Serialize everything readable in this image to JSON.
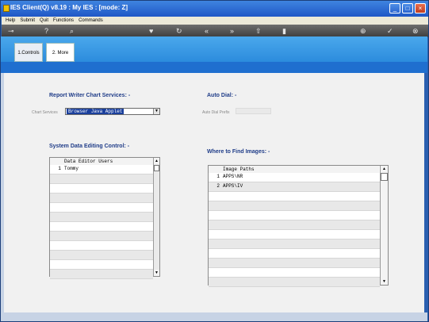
{
  "window": {
    "title": "IES Client(Q) v8.19 : My IES :     [mode: Z]",
    "minimize_glyph": "_",
    "maximize_glyph": "□",
    "close_glyph": "×"
  },
  "menubar": {
    "items": [
      "Help",
      "Submit",
      "Quit",
      "Functions",
      "Commands"
    ]
  },
  "toolbar": {
    "icons": [
      "key-icon",
      "help-icon",
      "search-icon",
      "heart-icon",
      "refresh-icon",
      "rewind-icon",
      "fast-forward-icon",
      "export-icon",
      "page-icon",
      "globe-icon",
      "check-icon",
      "close-icon"
    ],
    "glyphs": [
      "⊸",
      "?",
      "⌕",
      "♥",
      "↻",
      "«",
      "»",
      "⇧",
      "▮",
      "⊕",
      "✓",
      "⊗"
    ]
  },
  "tabs": [
    {
      "label": "1.Controls"
    },
    {
      "label": "2. More"
    }
  ],
  "report_writer": {
    "title": "Report Writer Chart Services: -",
    "field_label": "Chart Services",
    "value": "Browser Java Applet"
  },
  "auto_dial": {
    "title": "Auto Dial: -",
    "field_label": "Auto Dial Prefix",
    "value": ""
  },
  "system_data": {
    "title": "System Data Editing Control: -",
    "column_header": "Data Editor Users",
    "rows": [
      {
        "num": "1",
        "value": "Tommy"
      },
      {
        "num": "",
        "value": ""
      },
      {
        "num": "",
        "value": ""
      },
      {
        "num": "",
        "value": ""
      },
      {
        "num": "",
        "value": ""
      },
      {
        "num": "",
        "value": ""
      },
      {
        "num": "",
        "value": ""
      },
      {
        "num": "",
        "value": ""
      },
      {
        "num": "",
        "value": ""
      },
      {
        "num": "",
        "value": ""
      },
      {
        "num": "",
        "value": ""
      },
      {
        "num": "",
        "value": ""
      }
    ]
  },
  "images": {
    "title": "Where to Find Images: -",
    "column_header": "Image Paths",
    "rows": [
      {
        "num": "1",
        "value": "APPS\\NR"
      },
      {
        "num": "2",
        "value": "APPS\\IV"
      },
      {
        "num": "",
        "value": ""
      },
      {
        "num": "",
        "value": ""
      },
      {
        "num": "",
        "value": ""
      },
      {
        "num": "",
        "value": ""
      },
      {
        "num": "",
        "value": ""
      },
      {
        "num": "",
        "value": ""
      },
      {
        "num": "",
        "value": ""
      },
      {
        "num": "",
        "value": ""
      },
      {
        "num": "",
        "value": ""
      },
      {
        "num": "",
        "value": ""
      }
    ]
  },
  "scroll": {
    "up": "▲",
    "down": "▼"
  },
  "combo_arrow": "▼"
}
